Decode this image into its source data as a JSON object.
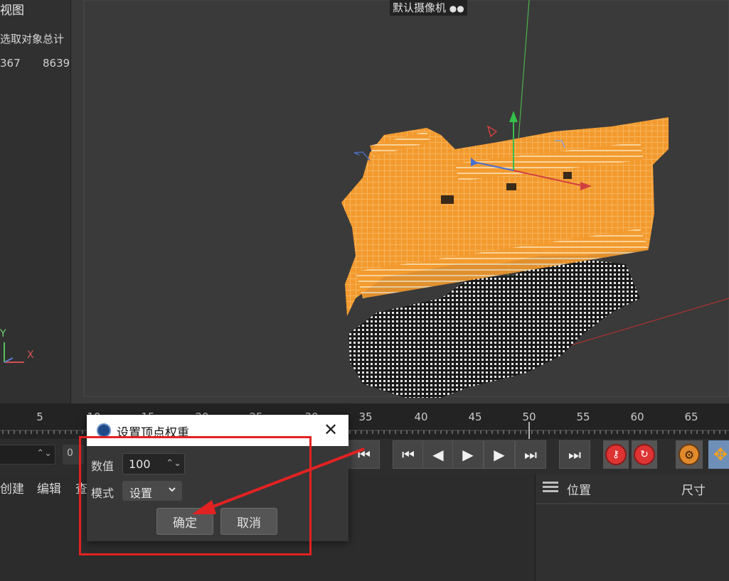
{
  "left_panel": {
    "title": "视图",
    "col1_header": "选取对象",
    "col2_header": "总计",
    "col1_value": "367",
    "col2_value": "8639",
    "axis_y": "Y",
    "axis_x": "X"
  },
  "viewport": {
    "camera_label": "默认摄像机",
    "camera_icon": "camera-icon"
  },
  "timeline": {
    "ticks": [
      "5",
      "10",
      "15",
      "20",
      "25",
      "30",
      "35",
      "40",
      "45",
      "50",
      "55",
      "60",
      "65"
    ]
  },
  "transport": {
    "frame_value": "0",
    "buttons": [
      "go-to-start",
      "prev-key",
      "prev-frame",
      "play",
      "next-frame",
      "next-key",
      "go-to-end"
    ],
    "record_icons": [
      "key-record-icon",
      "auto-key-icon"
    ],
    "settings_icon": "gear-icon",
    "move_icon": "move-icon"
  },
  "object_manager": {
    "menu_create": "创建",
    "menu_edit": "编辑",
    "menu_view": "查"
  },
  "attributes": {
    "position_label": "位置",
    "size_label": "尺寸"
  },
  "dialog": {
    "title": "设置顶点权重",
    "value_label": "数值",
    "value": "100",
    "mode_label": "模式",
    "mode_value": "设置",
    "ok_label": "确定",
    "cancel_label": "取消"
  },
  "colors": {
    "annotation": "#e22222",
    "object_orange": "#f39a2e",
    "accent_blue": "#6e8fb8"
  }
}
